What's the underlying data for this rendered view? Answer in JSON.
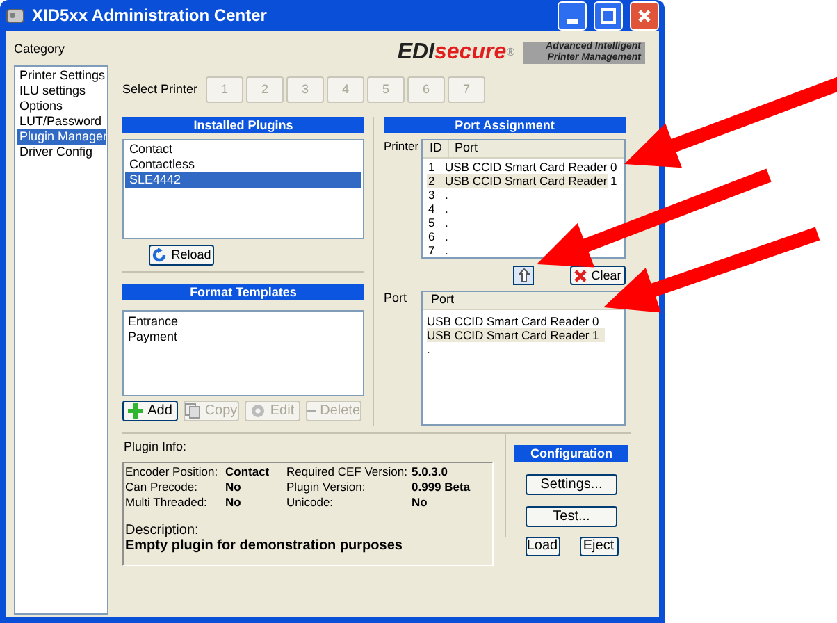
{
  "window": {
    "title": "XID5xx Administration Center"
  },
  "category": {
    "label": "Category",
    "items": [
      {
        "label": "Printer Settings",
        "selected": false
      },
      {
        "label": "ILU settings",
        "selected": false
      },
      {
        "label": "Options",
        "selected": false
      },
      {
        "label": "LUT/Password",
        "selected": false
      },
      {
        "label": "Plugin Manager",
        "selected": true
      },
      {
        "label": "Driver Config",
        "selected": false
      }
    ]
  },
  "logo": {
    "brand_dark": "EDI",
    "brand_red": "secure",
    "mark": "®",
    "tagline": "Advanced Intelligent Printer Management"
  },
  "select_printer": {
    "label": "Select Printer",
    "buttons": [
      {
        "label": "1",
        "disabled": true
      },
      {
        "label": "2",
        "disabled": true
      },
      {
        "label": "3",
        "disabled": true
      },
      {
        "label": "4",
        "disabled": true
      },
      {
        "label": "5",
        "disabled": true
      },
      {
        "label": "6",
        "disabled": true
      },
      {
        "label": "7",
        "disabled": true
      }
    ]
  },
  "installed_plugins": {
    "title": "Installed Plugins",
    "items": [
      {
        "label": "Contact",
        "selected": false
      },
      {
        "label": "Contactless",
        "selected": false
      },
      {
        "label": "SLE4442",
        "selected": true
      }
    ],
    "reload_button": "Reload"
  },
  "format_templates": {
    "title": "Format Templates",
    "items": [
      "Entrance",
      "Payment"
    ],
    "buttons": [
      {
        "kind": "add",
        "label": "Add",
        "disabled": false
      },
      {
        "kind": "copy",
        "label": "Copy",
        "disabled": true
      },
      {
        "kind": "edit",
        "label": "Edit",
        "disabled": true
      },
      {
        "kind": "delete",
        "label": "Delete",
        "disabled": true
      }
    ]
  },
  "port_assignment": {
    "title": "Port Assignment",
    "printer_label": "Printer",
    "printer_table": {
      "columns": [
        "ID",
        "Port"
      ],
      "rows": [
        {
          "id": "1",
          "port": "USB CCID Smart Card Reader 0",
          "selected": false
        },
        {
          "id": "2",
          "port": "USB CCID Smart Card Reader 1",
          "selected": true
        },
        {
          "id": "3",
          "port": ".",
          "selected": false
        },
        {
          "id": "4",
          "port": ".",
          "selected": false
        },
        {
          "id": "5",
          "port": ".",
          "selected": false
        },
        {
          "id": "6",
          "port": ".",
          "selected": false
        },
        {
          "id": "7",
          "port": ".",
          "selected": false
        }
      ]
    },
    "clear_button": "Clear",
    "port_label": "Port",
    "port_table": {
      "columns": [
        "Port"
      ],
      "rows": [
        {
          "port": "USB CCID Smart Card Reader 0",
          "selected": false
        },
        {
          "port": "USB CCID Smart Card Reader 1",
          "selected": true
        },
        {
          "port": ".",
          "selected": false
        }
      ]
    }
  },
  "plugin_info": {
    "label": "Plugin Info:",
    "fields": [
      {
        "label": "Encoder Position:",
        "value": "Contact"
      },
      {
        "label": "Required CEF Version:",
        "value": "5.0.3.0"
      },
      {
        "label": "Can Precode:",
        "value": "No"
      },
      {
        "label": "Plugin Version:",
        "value": "0.999 Beta"
      },
      {
        "label": "Multi Threaded:",
        "value": "No"
      },
      {
        "label": "Unicode:",
        "value": "No"
      }
    ],
    "description_label": "Description:",
    "description": "Empty plugin for demonstration purposes"
  },
  "configuration": {
    "title": "Configuration",
    "buttons": [
      "Settings...",
      "Test..."
    ],
    "load_button": "Load",
    "eject_button": "Eject"
  }
}
